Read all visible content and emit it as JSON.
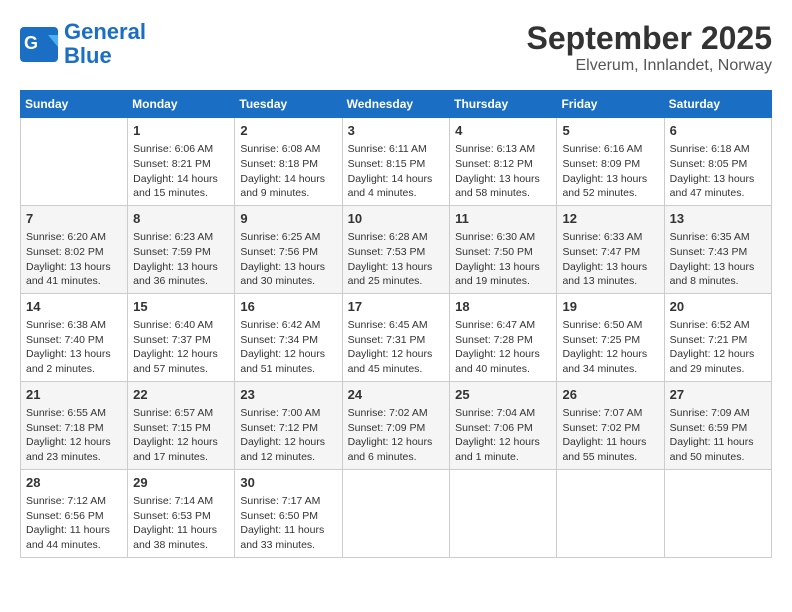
{
  "header": {
    "logo_line1": "General",
    "logo_line2": "Blue",
    "month": "September 2025",
    "location": "Elverum, Innlandet, Norway"
  },
  "days_of_week": [
    "Sunday",
    "Monday",
    "Tuesday",
    "Wednesday",
    "Thursday",
    "Friday",
    "Saturday"
  ],
  "weeks": [
    [
      {
        "day": "",
        "content": ""
      },
      {
        "day": "1",
        "content": "Sunrise: 6:06 AM\nSunset: 8:21 PM\nDaylight: 14 hours\nand 15 minutes."
      },
      {
        "day": "2",
        "content": "Sunrise: 6:08 AM\nSunset: 8:18 PM\nDaylight: 14 hours\nand 9 minutes."
      },
      {
        "day": "3",
        "content": "Sunrise: 6:11 AM\nSunset: 8:15 PM\nDaylight: 14 hours\nand 4 minutes."
      },
      {
        "day": "4",
        "content": "Sunrise: 6:13 AM\nSunset: 8:12 PM\nDaylight: 13 hours\nand 58 minutes."
      },
      {
        "day": "5",
        "content": "Sunrise: 6:16 AM\nSunset: 8:09 PM\nDaylight: 13 hours\nand 52 minutes."
      },
      {
        "day": "6",
        "content": "Sunrise: 6:18 AM\nSunset: 8:05 PM\nDaylight: 13 hours\nand 47 minutes."
      }
    ],
    [
      {
        "day": "7",
        "content": "Sunrise: 6:20 AM\nSunset: 8:02 PM\nDaylight: 13 hours\nand 41 minutes."
      },
      {
        "day": "8",
        "content": "Sunrise: 6:23 AM\nSunset: 7:59 PM\nDaylight: 13 hours\nand 36 minutes."
      },
      {
        "day": "9",
        "content": "Sunrise: 6:25 AM\nSunset: 7:56 PM\nDaylight: 13 hours\nand 30 minutes."
      },
      {
        "day": "10",
        "content": "Sunrise: 6:28 AM\nSunset: 7:53 PM\nDaylight: 13 hours\nand 25 minutes."
      },
      {
        "day": "11",
        "content": "Sunrise: 6:30 AM\nSunset: 7:50 PM\nDaylight: 13 hours\nand 19 minutes."
      },
      {
        "day": "12",
        "content": "Sunrise: 6:33 AM\nSunset: 7:47 PM\nDaylight: 13 hours\nand 13 minutes."
      },
      {
        "day": "13",
        "content": "Sunrise: 6:35 AM\nSunset: 7:43 PM\nDaylight: 13 hours\nand 8 minutes."
      }
    ],
    [
      {
        "day": "14",
        "content": "Sunrise: 6:38 AM\nSunset: 7:40 PM\nDaylight: 13 hours\nand 2 minutes."
      },
      {
        "day": "15",
        "content": "Sunrise: 6:40 AM\nSunset: 7:37 PM\nDaylight: 12 hours\nand 57 minutes."
      },
      {
        "day": "16",
        "content": "Sunrise: 6:42 AM\nSunset: 7:34 PM\nDaylight: 12 hours\nand 51 minutes."
      },
      {
        "day": "17",
        "content": "Sunrise: 6:45 AM\nSunset: 7:31 PM\nDaylight: 12 hours\nand 45 minutes."
      },
      {
        "day": "18",
        "content": "Sunrise: 6:47 AM\nSunset: 7:28 PM\nDaylight: 12 hours\nand 40 minutes."
      },
      {
        "day": "19",
        "content": "Sunrise: 6:50 AM\nSunset: 7:25 PM\nDaylight: 12 hours\nand 34 minutes."
      },
      {
        "day": "20",
        "content": "Sunrise: 6:52 AM\nSunset: 7:21 PM\nDaylight: 12 hours\nand 29 minutes."
      }
    ],
    [
      {
        "day": "21",
        "content": "Sunrise: 6:55 AM\nSunset: 7:18 PM\nDaylight: 12 hours\nand 23 minutes."
      },
      {
        "day": "22",
        "content": "Sunrise: 6:57 AM\nSunset: 7:15 PM\nDaylight: 12 hours\nand 17 minutes."
      },
      {
        "day": "23",
        "content": "Sunrise: 7:00 AM\nSunset: 7:12 PM\nDaylight: 12 hours\nand 12 minutes."
      },
      {
        "day": "24",
        "content": "Sunrise: 7:02 AM\nSunset: 7:09 PM\nDaylight: 12 hours\nand 6 minutes."
      },
      {
        "day": "25",
        "content": "Sunrise: 7:04 AM\nSunset: 7:06 PM\nDaylight: 12 hours\nand 1 minute."
      },
      {
        "day": "26",
        "content": "Sunrise: 7:07 AM\nSunset: 7:02 PM\nDaylight: 11 hours\nand 55 minutes."
      },
      {
        "day": "27",
        "content": "Sunrise: 7:09 AM\nSunset: 6:59 PM\nDaylight: 11 hours\nand 50 minutes."
      }
    ],
    [
      {
        "day": "28",
        "content": "Sunrise: 7:12 AM\nSunset: 6:56 PM\nDaylight: 11 hours\nand 44 minutes."
      },
      {
        "day": "29",
        "content": "Sunrise: 7:14 AM\nSunset: 6:53 PM\nDaylight: 11 hours\nand 38 minutes."
      },
      {
        "day": "30",
        "content": "Sunrise: 7:17 AM\nSunset: 6:50 PM\nDaylight: 11 hours\nand 33 minutes."
      },
      {
        "day": "",
        "content": ""
      },
      {
        "day": "",
        "content": ""
      },
      {
        "day": "",
        "content": ""
      },
      {
        "day": "",
        "content": ""
      }
    ]
  ]
}
